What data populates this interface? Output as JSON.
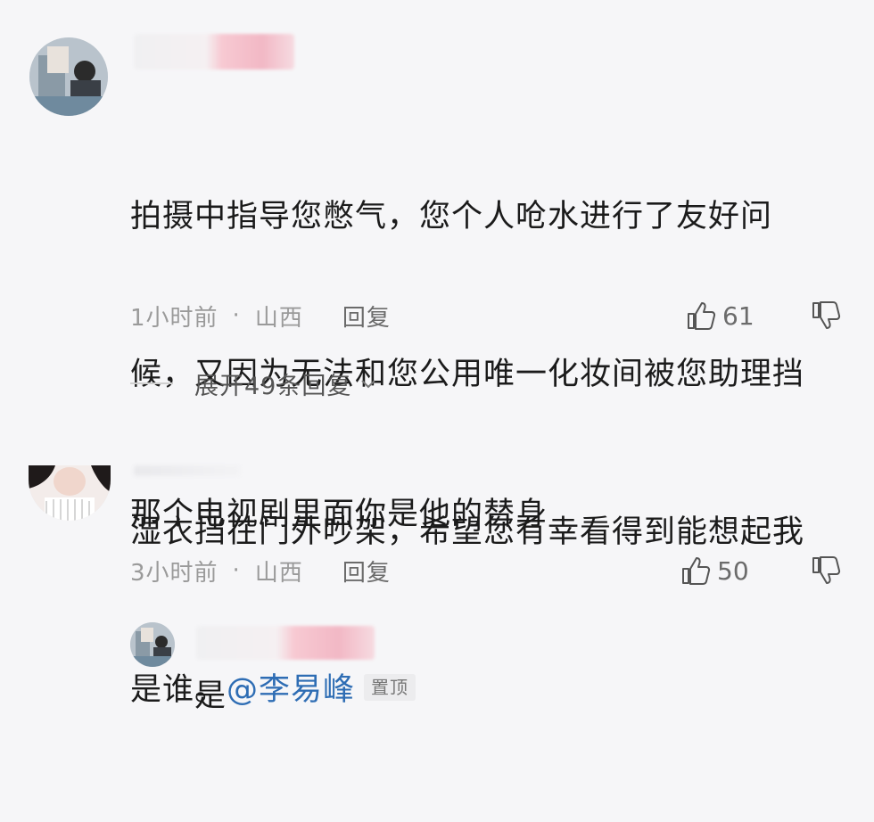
{
  "comments": [
    {
      "text_lines": [
        "拍摄中指导您憋气，您个人呛水进行了友好问",
        "候，又因为无法和您公用唯一化妆间被您助理挡",
        "湿衣挡在门外吵架，希望您有幸看得到能想起我",
        "是谁。"
      ],
      "mention": "@李易峰",
      "pin_badge": "置顶",
      "time": "1小时前",
      "location": "山西",
      "reply_label": "回复",
      "likes": "61",
      "expand_label": "展开49条回复"
    },
    {
      "text": "那个电视剧里面你是他的替身",
      "time": "3小时前",
      "location": "山西",
      "reply_label": "回复",
      "likes": "50"
    },
    {
      "text": "是"
    }
  ],
  "icons": {
    "like": "thumbs-up-icon",
    "dislike": "thumbs-down-icon",
    "expand": "chevron-down-icon"
  },
  "colors": {
    "background": "#f6f6f8",
    "mention": "#2e6db4",
    "meta": "#9a9a9a"
  }
}
